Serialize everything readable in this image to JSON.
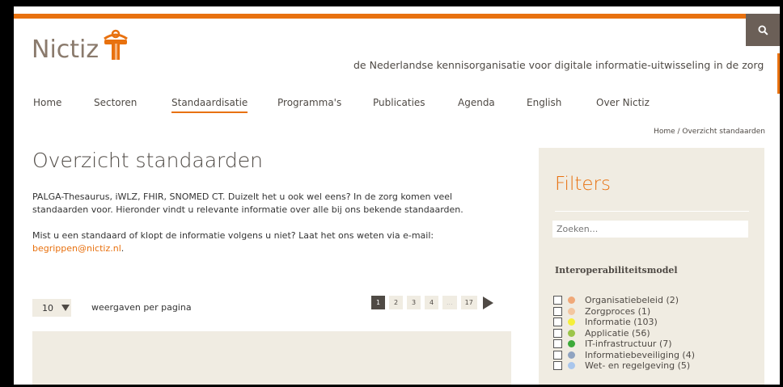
{
  "header": {
    "logo_text": "Nictiz",
    "tagline": "de Nederlandse kennisorganisatie voor digitale informatie-uitwisseling in de zorg",
    "accent_color": "#e8710f"
  },
  "nav": {
    "items": [
      {
        "label": "Home"
      },
      {
        "label": "Sectoren"
      },
      {
        "label": "Standaardisatie"
      },
      {
        "label": "Programma's"
      },
      {
        "label": "Publicaties"
      },
      {
        "label": "Agenda"
      },
      {
        "label": "English"
      },
      {
        "label": "Over Nictiz"
      }
    ],
    "active": "Standaardisatie"
  },
  "breadcrumb": "Home / Overzicht standaarden",
  "main": {
    "title": "Overzicht standaarden",
    "intro": "PALGA-Thesaurus, iWLZ, FHIR, SNOMED CT. Duizelt het u ook wel eens? In de zorg komen veel standaarden voor. Hieronder vindt u relevante informatie over alle bij ons bekende standaarden.",
    "intro2_text": "Mist u een standaard of klopt de informatie volgens u niet? Laat het ons weten via e-mail:",
    "email": "begrippen@nictiz.nl",
    "email_suffix": "."
  },
  "pagination": {
    "per_page_value": "10",
    "per_page_label": "weergaven per pagina",
    "pages": [
      "1",
      "2",
      "3",
      "4",
      "...",
      "17"
    ],
    "current": "1"
  },
  "filters": {
    "title": "Filters",
    "search_placeholder": "Zoeken...",
    "heading": "Interoperabiliteitsmodel",
    "items": [
      {
        "label": "Organisatiebeleid (2)",
        "color": "#f0a878"
      },
      {
        "label": "Zorgproces (1)",
        "color": "#f3c6a0"
      },
      {
        "label": "Informatie (103)",
        "color": "#f5ef3a"
      },
      {
        "label": "Applicatie (56)",
        "color": "#9cc54a"
      },
      {
        "label": "IT-infrastructuur (7)",
        "color": "#3daa3a"
      },
      {
        "label": "Informatiebeveiliging (4)",
        "color": "#8fa3c0"
      },
      {
        "label": "Wet- en regelgeving (5)",
        "color": "#a9c6ec"
      }
    ]
  }
}
